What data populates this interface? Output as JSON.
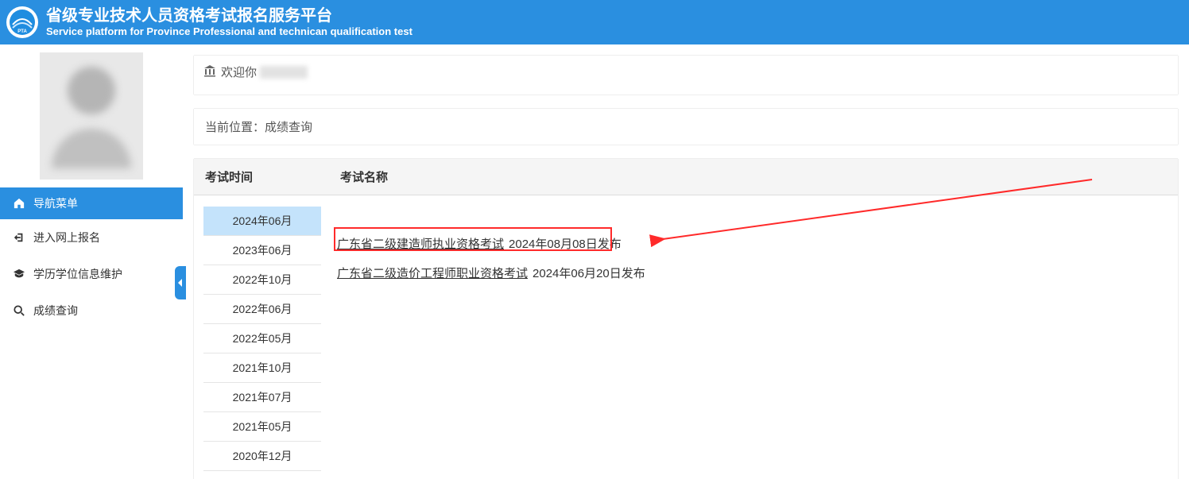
{
  "header": {
    "title_cn": "省级专业技术人员资格考试报名服务平台",
    "title_en": "Service platform for Province Professional and technican qualification test",
    "logo_text": "PTA"
  },
  "sidebar": {
    "nav_header": "导航菜单",
    "items": [
      {
        "label": "进入网上报名",
        "icon": "login-icon"
      },
      {
        "label": "学历学位信息维护",
        "icon": "graduation-cap-icon"
      },
      {
        "label": "成绩查询",
        "icon": "search-icon"
      }
    ]
  },
  "main": {
    "welcome_prefix": "欢迎你",
    "breadcrumb": "当前位置：成绩查询",
    "table_head": {
      "time": "考试时间",
      "name": "考试名称"
    },
    "time_items": [
      {
        "label": "2024年06月",
        "selected": true
      },
      {
        "label": "2023年06月",
        "selected": false
      },
      {
        "label": "2022年10月",
        "selected": false
      },
      {
        "label": "2022年06月",
        "selected": false
      },
      {
        "label": "2022年05月",
        "selected": false
      },
      {
        "label": "2021年10月",
        "selected": false
      },
      {
        "label": "2021年07月",
        "selected": false
      },
      {
        "label": "2021年05月",
        "selected": false
      },
      {
        "label": "2020年12月",
        "selected": false
      }
    ],
    "exams": [
      {
        "link": "广东省二级建造师执业资格考试",
        "published": "2024年08月08日发布",
        "highlighted": true
      },
      {
        "link": "广东省二级造价工程师职业资格考试",
        "published": "2024年06月20日发布",
        "highlighted": false
      }
    ]
  }
}
